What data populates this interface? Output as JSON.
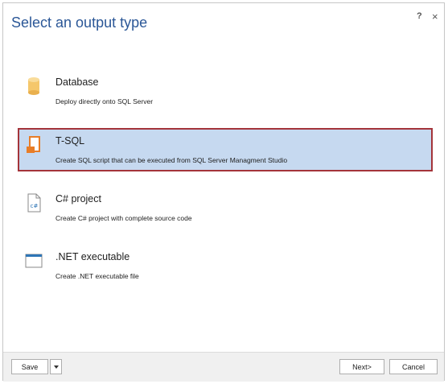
{
  "dialog": {
    "title": "Select an output type",
    "help_label": "?",
    "close_label": "×"
  },
  "options": [
    {
      "name": "Database",
      "description": "Deploy directly onto SQL Server",
      "icon": "database-icon",
      "selected": false
    },
    {
      "name": "T-SQL",
      "description": "Create SQL script that can be executed from SQL Server Managment Studio",
      "icon": "sql-script-icon",
      "selected": true
    },
    {
      "name": "C# project",
      "description": "Create C# project with complete source code",
      "icon": "csharp-file-icon",
      "selected": false
    },
    {
      "name": ".NET executable",
      "description": "Create .NET executable file",
      "icon": "window-icon",
      "selected": false
    }
  ],
  "footer": {
    "save_label": "Save",
    "next_label": "Next>",
    "cancel_label": "Cancel"
  },
  "colors": {
    "title": "#2b5797",
    "selected_bg": "#c6d9f0",
    "selected_border": "#a4343a",
    "icon_orange": "#e87d27",
    "icon_yellow": "#f5c76b",
    "icon_blue": "#2e75b6"
  }
}
